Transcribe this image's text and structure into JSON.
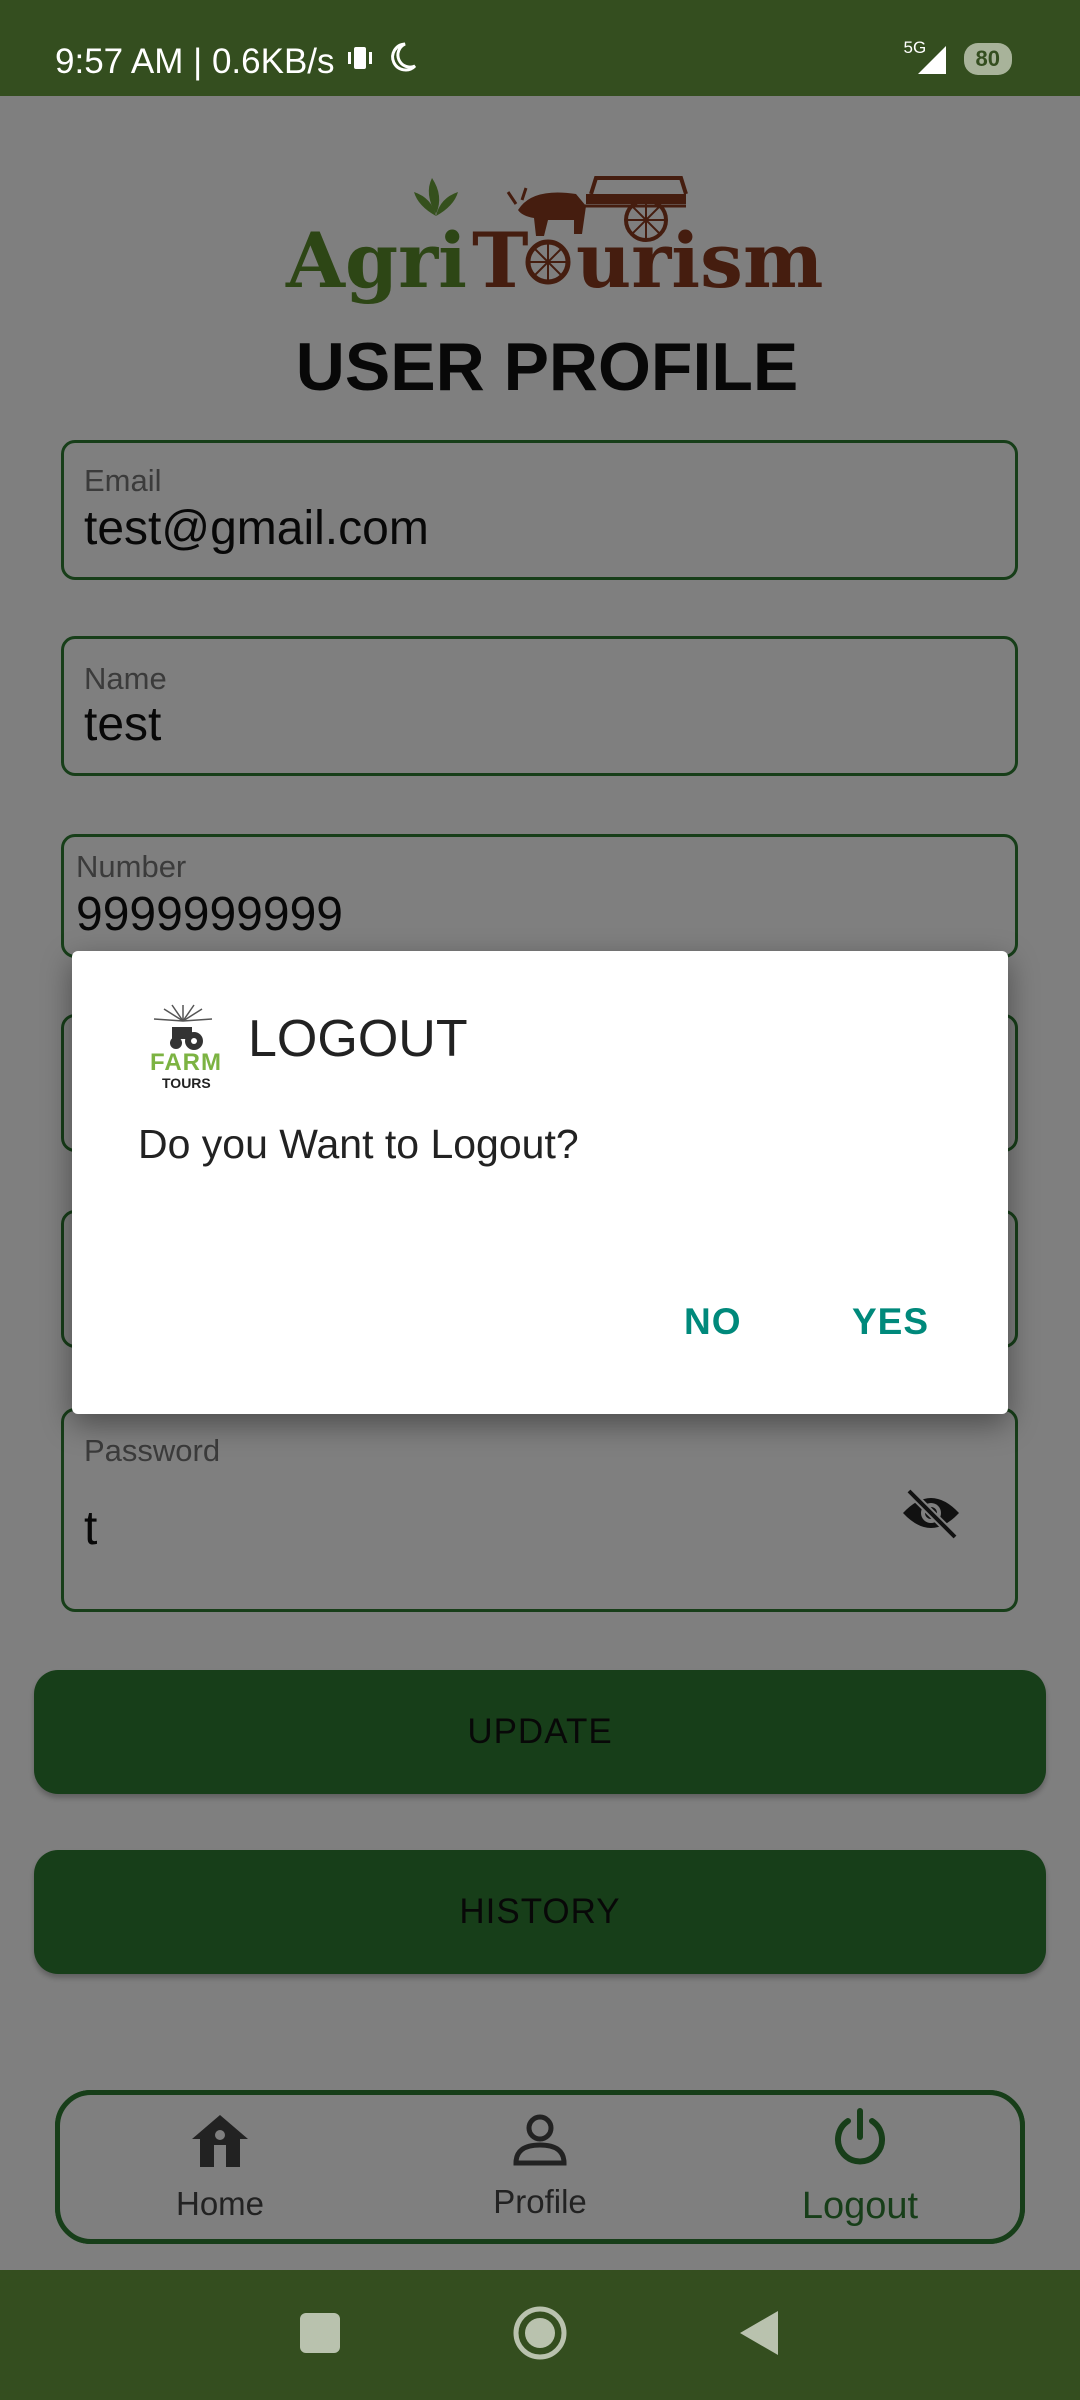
{
  "status_bar": {
    "time_speed": "9:57 AM | 0.6KB/s",
    "network": "5G",
    "battery": "80"
  },
  "logo": {
    "word1": "Agri",
    "word2_prefix": "T",
    "word2_suffix": "urism"
  },
  "page_title": "USER PROFILE",
  "fields": {
    "email": {
      "label": "Email",
      "value": "test@gmail.com"
    },
    "name": {
      "label": "Name",
      "value": "test"
    },
    "number": {
      "label": "Number",
      "value": "9999999999"
    },
    "password": {
      "label": "Password",
      "value": "t"
    }
  },
  "buttons": {
    "update": "UPDATE",
    "history": "HISTORY"
  },
  "bottom_nav": {
    "home": "Home",
    "profile": "Profile",
    "logout": "Logout"
  },
  "dialog": {
    "logo_top": "FARM",
    "logo_bottom": "TOURS",
    "title": "LOGOUT",
    "message": "Do you Want to Logout?",
    "no": "NO",
    "yes": "YES"
  },
  "colors": {
    "brand_green": "#2e7d32",
    "status_bar": "#344e1f",
    "dialog_action": "#00897b"
  }
}
